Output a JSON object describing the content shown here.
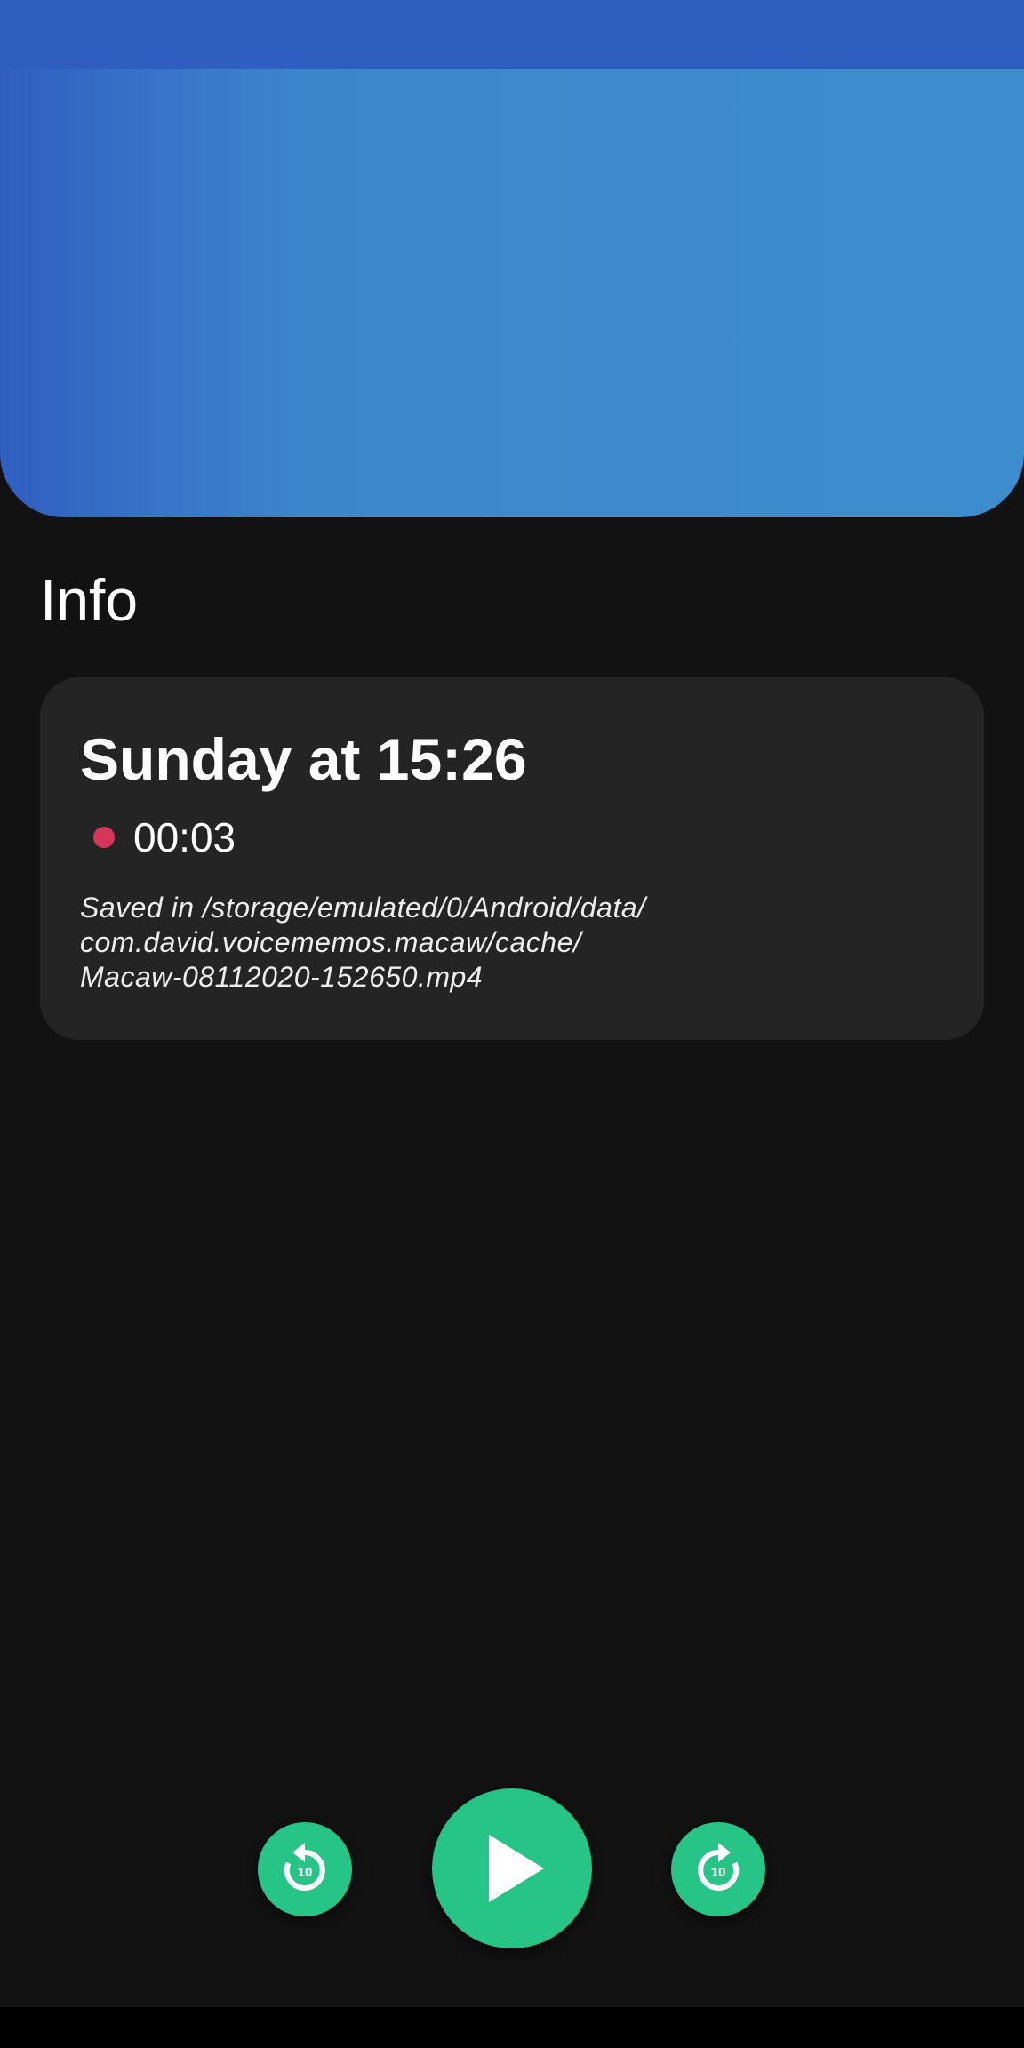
{
  "section": {
    "title": "Info"
  },
  "card": {
    "date": "Sunday at 15:26",
    "duration": "00:03",
    "save_path": "Saved in /storage/emulated/0/Android/data/\ncom.david.voicememos.macaw/cache/\nMacaw-08112020-152650.mp4"
  },
  "player": {
    "rewind_seconds": "10",
    "forward_seconds": "10",
    "rewind_icon": "replay-10-icon",
    "play_icon": "play-icon",
    "forward_icon": "forward-10-icon"
  },
  "colors": {
    "header_start": "#2f5ec1",
    "header_end": "#3d8dce",
    "accent": "#26c487",
    "record_dot": "#d6365a",
    "background": "#121212",
    "card": "#242424"
  }
}
